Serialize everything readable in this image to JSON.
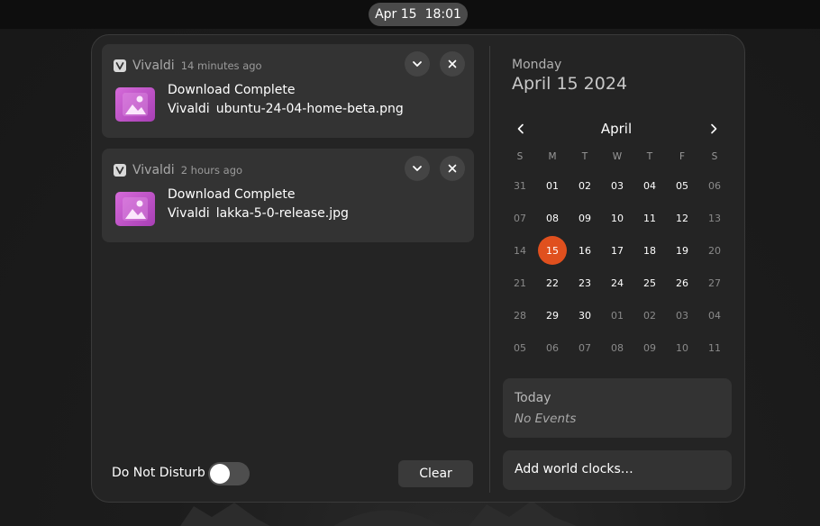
{
  "topbar": {
    "date": "Apr 15",
    "time": "18:01"
  },
  "notifications": [
    {
      "app": "Vivaldi",
      "time": "14 minutes ago",
      "title": "Download Complete",
      "source": "Vivaldi",
      "file": "ubuntu-24-04-home-beta.png"
    },
    {
      "app": "Vivaldi",
      "time": "2 hours ago",
      "title": "Download Complete",
      "source": "Vivaldi",
      "file": "lakka-5-0-release.jpg"
    }
  ],
  "footer": {
    "dnd_label": "Do Not Disturb",
    "dnd_enabled": false,
    "clear_label": "Clear"
  },
  "calendar": {
    "weekday": "Monday",
    "full_date": "April 15 2024",
    "month": "April",
    "day_headers": [
      "S",
      "M",
      "T",
      "W",
      "T",
      "F",
      "S"
    ],
    "weeks": [
      [
        [
          "31",
          "dim"
        ],
        [
          "01",
          "day"
        ],
        [
          "02",
          "day"
        ],
        [
          "03",
          "day"
        ],
        [
          "04",
          "day"
        ],
        [
          "05",
          "day"
        ],
        [
          "06",
          "dim"
        ]
      ],
      [
        [
          "07",
          "dim"
        ],
        [
          "08",
          "day"
        ],
        [
          "09",
          "day"
        ],
        [
          "10",
          "day"
        ],
        [
          "11",
          "day"
        ],
        [
          "12",
          "day"
        ],
        [
          "13",
          "dim"
        ]
      ],
      [
        [
          "14",
          "dim"
        ],
        [
          "15",
          "today"
        ],
        [
          "16",
          "day"
        ],
        [
          "17",
          "day"
        ],
        [
          "18",
          "day"
        ],
        [
          "19",
          "day"
        ],
        [
          "20",
          "dim"
        ]
      ],
      [
        [
          "21",
          "dim"
        ],
        [
          "22",
          "day"
        ],
        [
          "23",
          "day"
        ],
        [
          "24",
          "day"
        ],
        [
          "25",
          "day"
        ],
        [
          "26",
          "day"
        ],
        [
          "27",
          "dim"
        ]
      ],
      [
        [
          "28",
          "dim"
        ],
        [
          "29",
          "day"
        ],
        [
          "30",
          "day"
        ],
        [
          "01",
          "dim"
        ],
        [
          "02",
          "dim"
        ],
        [
          "03",
          "dim"
        ],
        [
          "04",
          "dim"
        ]
      ],
      [
        [
          "05",
          "dim"
        ],
        [
          "06",
          "dim"
        ],
        [
          "07",
          "dim"
        ],
        [
          "08",
          "dim"
        ],
        [
          "09",
          "dim"
        ],
        [
          "10",
          "dim"
        ],
        [
          "11",
          "dim"
        ]
      ]
    ]
  },
  "events": {
    "title": "Today",
    "empty_text": "No Events"
  },
  "world_clocks": {
    "label": "Add world clocks…"
  },
  "colors": {
    "accent": "#e0501e",
    "panel": "#242424",
    "card": "#333333"
  },
  "icons": {
    "app": "vivaldi-icon",
    "thumbnail": "image-file-icon",
    "expand": "chevron-down-icon",
    "close": "close-icon",
    "prev_month": "chevron-left-icon",
    "next_month": "chevron-right-icon"
  }
}
